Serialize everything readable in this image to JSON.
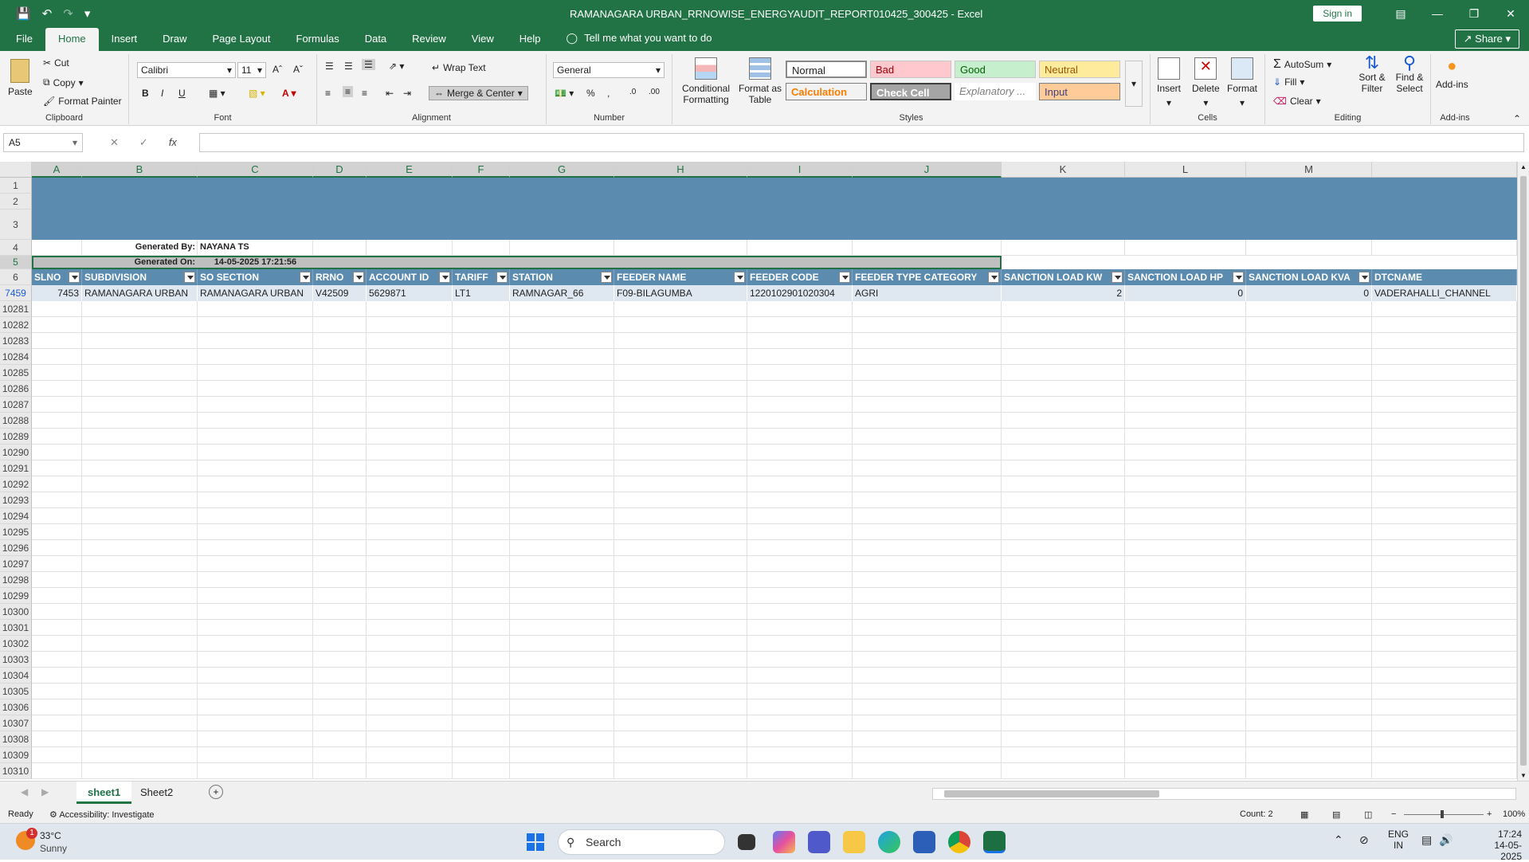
{
  "window": {
    "title": "RAMANAGARA URBAN_RRNOWISE_ENERGYAUDIT_REPORT010425_300425  -  Excel",
    "sign_in": "Sign in",
    "share": "Share"
  },
  "menu": {
    "tabs": [
      "File",
      "Home",
      "Insert",
      "Draw",
      "Page Layout",
      "Formulas",
      "Data",
      "Review",
      "View",
      "Help"
    ],
    "active": "Home",
    "tell_me": "Tell me what you want to do"
  },
  "ribbon": {
    "clipboard": {
      "paste": "Paste",
      "cut": "Cut",
      "copy": "Copy",
      "format_painter": "Format Painter",
      "label": "Clipboard"
    },
    "font": {
      "name": "Calibri",
      "size": "11",
      "bold": "B",
      "italic": "I",
      "underline": "U",
      "label": "Font"
    },
    "alignment": {
      "wrap": "Wrap Text",
      "merge": "Merge & Center",
      "label": "Alignment"
    },
    "number": {
      "format": "General",
      "label": "Number"
    },
    "styles": {
      "conditional": "Conditional Formatting",
      "format_table": "Format as Table",
      "normal": "Normal",
      "bad": "Bad",
      "good": "Good",
      "neutral": "Neutral",
      "calculation": "Calculation",
      "check_cell": "Check Cell",
      "explanatory": "Explanatory ...",
      "input": "Input",
      "label": "Styles"
    },
    "cells": {
      "insert": "Insert",
      "delete": "Delete",
      "format": "Format",
      "label": "Cells"
    },
    "editing": {
      "autosum": "AutoSum",
      "fill": "Fill",
      "clear": "Clear",
      "sort": "Sort & Filter",
      "find": "Find & Select",
      "label": "Editing"
    },
    "addins": {
      "addins": "Add-ins",
      "label": "Add-ins"
    }
  },
  "formula_bar": {
    "name_box": "A5",
    "fx": "fx",
    "value": ""
  },
  "columns": [
    "A",
    "B",
    "C",
    "D",
    "E",
    "F",
    "G",
    "H",
    "I",
    "J",
    "K",
    "L",
    "M"
  ],
  "rows_top": [
    "1",
    "2",
    "3",
    "4",
    "5",
    "6",
    "7459"
  ],
  "rows_empty": [
    "10281",
    "10282",
    "10283",
    "10284",
    "10285",
    "10286",
    "10287",
    "10288",
    "10289",
    "10290",
    "10291",
    "10292",
    "10293",
    "10294",
    "10295",
    "10296",
    "10297",
    "10298",
    "10299",
    "10300",
    "10301",
    "10302",
    "10303",
    "10304",
    "10305",
    "10306",
    "10307",
    "10308",
    "10309",
    "10310"
  ],
  "sheet": {
    "generated_by_label": "Generated By:",
    "generated_by": "NAYANA TS",
    "generated_on_label": "Generated On:",
    "generated_on": "14-05-2025 17:21:56",
    "headers": [
      "SLNO",
      "SUBDIVISION",
      "SO SECTION",
      "RRNO",
      "ACCOUNT ID",
      "TARIFF",
      "STATION",
      "FEEDER NAME",
      "FEEDER CODE",
      "FEEDER TYPE CATEGORY",
      "SANCTION LOAD KW",
      "SANCTION LOAD HP",
      "SANCTION LOAD KVA",
      "DTCNAME"
    ],
    "row": [
      "7453",
      "RAMANAGARA URBAN",
      "RAMANAGARA URBAN",
      "V42509",
      "5629871",
      "LT1",
      "RAMNAGAR_66",
      "F09-BILAGUMBA",
      "1220102901020304",
      "AGRI",
      "2",
      "0",
      "0",
      "VADERAHALLI_CHANNEL"
    ]
  },
  "sheet_tabs": [
    "sheet1",
    "Sheet2"
  ],
  "status": {
    "ready": "Ready",
    "accessibility": "Accessibility: Investigate",
    "count": "Count: 2",
    "zoom": "100%"
  },
  "taskbar": {
    "temp": "33°C",
    "weather": "Sunny",
    "badge": "1",
    "search": "Search",
    "lang1": "ENG",
    "lang2": "IN",
    "time": "17:24",
    "date": "14-05-2025"
  }
}
